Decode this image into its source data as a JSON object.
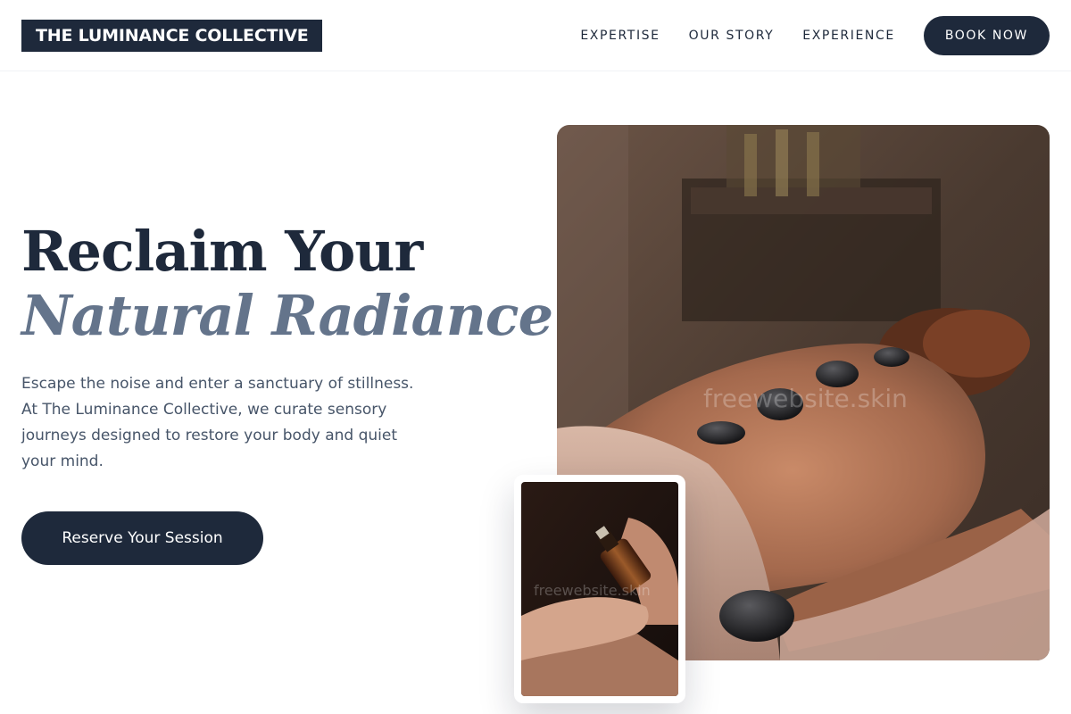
{
  "brand": {
    "logo_text": "THE LUMINANCE COLLECTIVE"
  },
  "nav": {
    "items": [
      {
        "label": "EXPERTISE"
      },
      {
        "label": "OUR STORY"
      },
      {
        "label": "EXPERIENCE"
      }
    ],
    "cta_label": "BOOK NOW"
  },
  "hero": {
    "title_line1": "Reclaim Your",
    "title_line2": "Natural Radiance",
    "description": "Escape the noise and enter a sanctuary of stillness. At The Luminance Collective, we curate sensory journeys designed to restore your body and quiet your mind.",
    "cta_label": "Reserve Your Session"
  },
  "images": {
    "main_alt": "hot-stone-massage-photo",
    "secondary_alt": "massage-oil-bottle-photo",
    "watermark": "freewebsite.skin"
  },
  "colors": {
    "primary": "#1e293b",
    "accent_text": "#64748b",
    "body_text": "#475569",
    "background": "#ffffff"
  }
}
